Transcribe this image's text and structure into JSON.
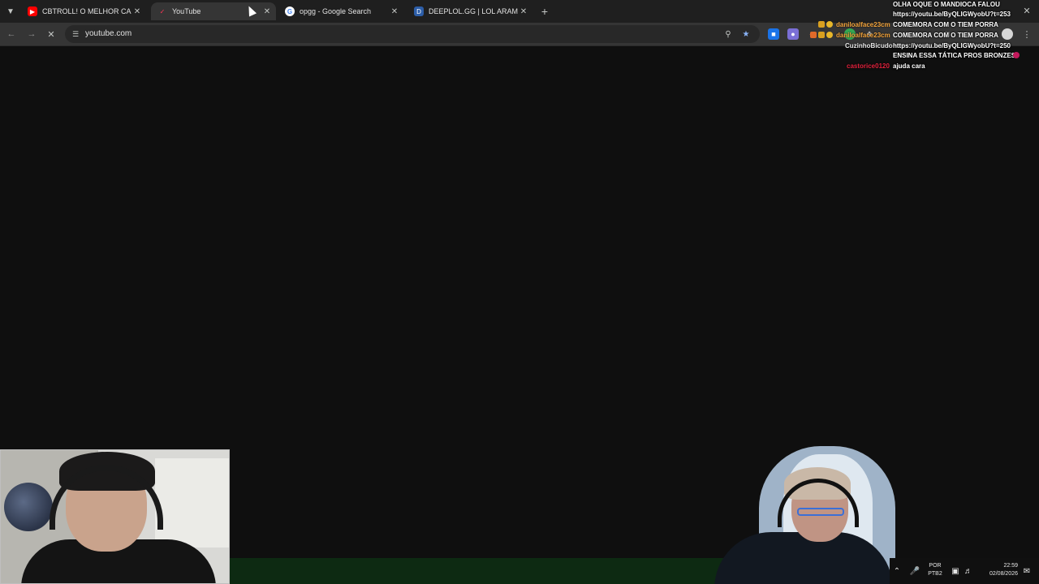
{
  "tabs": [
    {
      "title": "CBTROLL! O MELHOR CAMPEONATO",
      "favicon": "youtube-icon",
      "color": "#ff0000"
    },
    {
      "title": "YouTube",
      "favicon": "youtube-icon",
      "color": "#ff0033"
    },
    {
      "title": "opgg - Google Search",
      "favicon": "google-icon",
      "color": "#4285f4"
    },
    {
      "title": "DEEPLOL.GG | LOL ARAM STATS",
      "favicon": "deeplol-icon",
      "color": "#3a7bd5"
    }
  ],
  "address_bar": {
    "url": "youtube.com"
  },
  "chat": {
    "lines": [
      {
        "user": "",
        "message": "OLHA OQUE O MANDIOCA FALOU",
        "user_color": "#ffffff"
      },
      {
        "user": "",
        "message": "https://youtu.be/ByQLIGWyobU?t=253",
        "user_color": "#ffffff"
      },
      {
        "user": "daniloalface23cm",
        "message": "COMEMORA COM O TIEM PORRA",
        "user_color": "#f2a33a"
      },
      {
        "user": "daniloalface23cm",
        "message": "COMEMORA COM O TIEM PORRA",
        "user_color": "#f2a33a"
      },
      {
        "user": "CuzinhoBicudo",
        "message": "https://youtu.be/ByQLIGWyobU?t=250",
        "user_color": "#e8e8e8"
      },
      {
        "user": "",
        "message": "ENSINA ESSA TÁTICA PROS BRONZES",
        "user_color": "#ffffff"
      },
      {
        "user": "castorice0120",
        "message": "ajuda cara",
        "user_color": "#e0213c"
      }
    ]
  },
  "taskbar": {
    "lang_line1": "POR",
    "lang_line2": "PTB2",
    "time": "22:59",
    "date": "02/08/2026"
  },
  "colors": {
    "tabstrip_bg": "#1f1f1f",
    "toolbar_bg": "#353535",
    "page_bg": "#0f0f0f"
  }
}
